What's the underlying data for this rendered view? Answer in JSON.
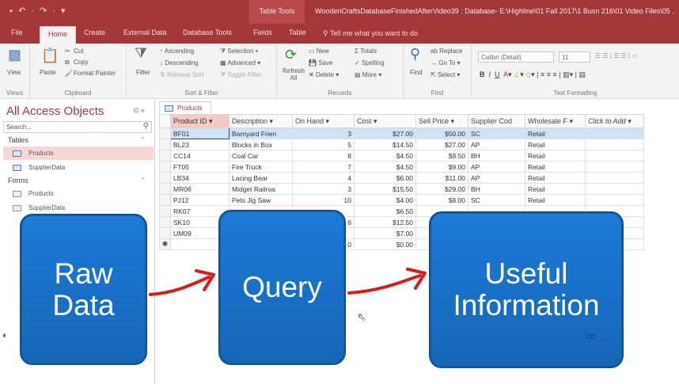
{
  "title_bar": {
    "quick_access": "▪ ↶ · ↷ · ▾",
    "context_tab": "Table Tools",
    "title": "WoodenCraftsDatabaseFinishedAfterVideo39 : Database- E:\\Highline\\01 Fall 2017\\1 Busn 216\\01 Video Files\\05 ..."
  },
  "ribbon_tabs": [
    "File",
    "Home",
    "Create",
    "External Data",
    "Database Tools",
    "Fields",
    "Table"
  ],
  "tell_me": "Tell me what you want to do",
  "ribbon": {
    "views": {
      "view": "View",
      "label": "Views"
    },
    "clipboard": {
      "paste": "Paste",
      "cut": "Cut",
      "copy": "Copy",
      "format_painter": "Format Painter",
      "label": "Clipboard"
    },
    "sort_filter": {
      "filter": "Filter",
      "ascending": "Ascending",
      "descending": "Descending",
      "remove_sort": "Remove Sort",
      "selection": "Selection",
      "advanced": "Advanced",
      "toggle_filter": "Toggle Filter",
      "label": "Sort & Filter"
    },
    "records": {
      "refresh": "Refresh All",
      "new": "New",
      "save": "Save",
      "delete": "Delete",
      "totals": "Totals",
      "spelling": "Spelling",
      "more": "More",
      "label": "Records"
    },
    "find": {
      "find": "Find",
      "replace": "Replace",
      "goto": "Go To",
      "select": "Select",
      "label": "Find"
    },
    "text_formatting": {
      "font": "Calibri (Detail)",
      "size": "11",
      "label": "Text Formatting"
    }
  },
  "nav_pane": {
    "title": "All Access Objects",
    "search_placeholder": "Search...",
    "tables_label": "Tables",
    "forms_label": "Forms",
    "tables": [
      "Products",
      "SupplierData"
    ],
    "forms": [
      "Products",
      "SupplierData"
    ]
  },
  "document": {
    "tab": "Products",
    "columns": [
      "Product ID",
      "Description",
      "On Hand",
      "Cost",
      "Sell Price",
      "Supplier Cod",
      "Wholesale F",
      "Click to Add"
    ],
    "rows": [
      [
        "BF01",
        "Barnyard Frien",
        "3",
        "$27.00",
        "$50.00",
        "SC",
        "Retail"
      ],
      [
        "BL23",
        "Blocks in Box",
        "5",
        "$14.50",
        "$27.00",
        "AP",
        "Retail"
      ],
      [
        "CC14",
        "Coal Car",
        "8",
        "$4.50",
        "$8.50",
        "BH",
        "Retail"
      ],
      [
        "FT05",
        "Fire Truck",
        "7",
        "$4.50",
        "$9.00",
        "AP",
        "Retail"
      ],
      [
        "LB34",
        "Lacing Bear",
        "4",
        "$6.00",
        "$11.00",
        "AP",
        "Retail"
      ],
      [
        "MR06",
        "Midget Railroa",
        "3",
        "$15.50",
        "$29.00",
        "BH",
        "Retail"
      ],
      [
        "PJ12",
        "Pets Jig Saw",
        "10",
        "$4.00",
        "$8.00",
        "SC",
        "Retail"
      ],
      [
        "RK07",
        "",
        "",
        "$6.50",
        "",
        "",
        ""
      ],
      [
        "SK10",
        "",
        "6",
        "$12.50",
        "",
        "",
        ""
      ],
      [
        "UM09",
        "",
        "",
        "$7.00",
        "",
        "",
        ""
      ],
      [
        "",
        "",
        "0",
        "$0.00",
        "",
        "",
        ""
      ]
    ]
  },
  "overlay": {
    "box1": "Raw Data",
    "box2": "Query",
    "box3": "Useful Information",
    "arrow_color": "#d41f1f",
    "box_color": "#1a6fc9"
  }
}
